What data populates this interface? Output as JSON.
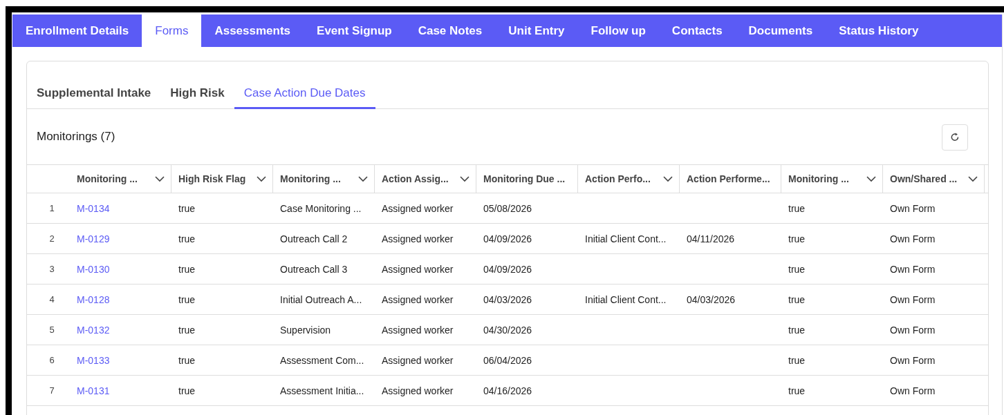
{
  "tabs": [
    {
      "label": "Enrollment Details",
      "selected": false
    },
    {
      "label": "Forms",
      "selected": true
    },
    {
      "label": "Assessments",
      "selected": false
    },
    {
      "label": "Event Signup",
      "selected": false
    },
    {
      "label": "Case Notes",
      "selected": false
    },
    {
      "label": "Unit Entry",
      "selected": false
    },
    {
      "label": "Follow up",
      "selected": false
    },
    {
      "label": "Contacts",
      "selected": false
    },
    {
      "label": "Documents",
      "selected": false
    },
    {
      "label": "Status History",
      "selected": false
    }
  ],
  "sub_tabs": [
    {
      "label": "Supplemental Intake",
      "selected": false
    },
    {
      "label": "High Risk",
      "selected": false
    },
    {
      "label": "Case Action Due Dates",
      "selected": true
    }
  ],
  "table": {
    "title": "Monitorings (7)",
    "columns": [
      {
        "label": "Monitoring ...",
        "menu": true
      },
      {
        "label": "High Risk Flag",
        "menu": true
      },
      {
        "label": "Monitoring ...",
        "menu": true
      },
      {
        "label": "Action Assig...",
        "menu": true
      },
      {
        "label": "Monitoring Due ...",
        "menu": false
      },
      {
        "label": "Action Perfo...",
        "menu": true
      },
      {
        "label": "Action Performe...",
        "menu": false
      },
      {
        "label": "Monitoring ...",
        "menu": true
      },
      {
        "label": "Own/Shared ...",
        "menu": true
      }
    ],
    "rows": [
      {
        "number": "1",
        "cells": [
          "M-0134",
          "true",
          "Case Monitoring ...",
          "Assigned worker",
          "05/08/2026",
          "",
          "",
          "true",
          "Own Form"
        ]
      },
      {
        "number": "2",
        "cells": [
          "M-0129",
          "true",
          "Outreach Call 2",
          "Assigned worker",
          "04/09/2026",
          "Initial Client Cont...",
          "04/11/2026",
          "true",
          "Own Form"
        ]
      },
      {
        "number": "3",
        "cells": [
          "M-0130",
          "true",
          "Outreach Call 3",
          "Assigned worker",
          "04/09/2026",
          "",
          "",
          "true",
          "Own Form"
        ]
      },
      {
        "number": "4",
        "cells": [
          "M-0128",
          "true",
          "Initial Outreach A...",
          "Assigned worker",
          "04/03/2026",
          "Initial Client Cont...",
          "04/03/2026",
          "true",
          "Own Form"
        ]
      },
      {
        "number": "5",
        "cells": [
          "M-0132",
          "true",
          "Supervision",
          "Assigned worker",
          "04/30/2026",
          "",
          "",
          "true",
          "Own Form"
        ]
      },
      {
        "number": "6",
        "cells": [
          "M-0133",
          "true",
          "Assessment Com...",
          "Assigned worker",
          "06/04/2026",
          "",
          "",
          "true",
          "Own Form"
        ]
      },
      {
        "number": "7",
        "cells": [
          "M-0131",
          "true",
          "Assessment Initia...",
          "Assigned worker",
          "04/16/2026",
          "",
          "",
          "true",
          "Own Form"
        ]
      }
    ]
  }
}
